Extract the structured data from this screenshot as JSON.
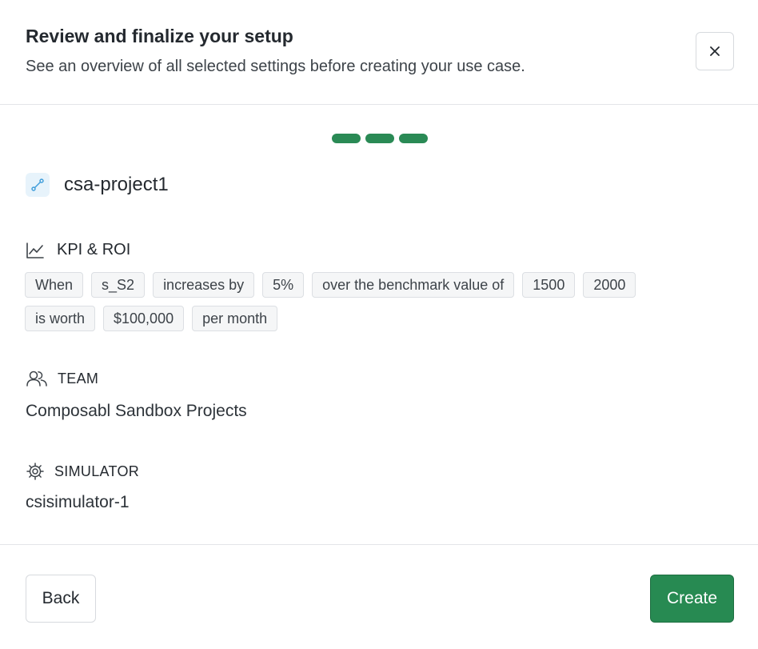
{
  "header": {
    "title": "Review and finalize your setup",
    "subtitle": "See an overview of all selected settings before creating your use case."
  },
  "stepper": {
    "steps_total": 3,
    "steps_completed": 3
  },
  "project": {
    "name": "csa-project1",
    "icon": "path-icon"
  },
  "kpi": {
    "label": "KPI & ROI",
    "icon": "trend-chart-icon",
    "chips": [
      "When",
      "s_S2",
      "increases by",
      "5%",
      "over the benchmark value of",
      "1500",
      "2000",
      "is worth",
      "$100,000",
      "per month"
    ]
  },
  "team": {
    "label": "TEAM",
    "icon": "users-icon",
    "value": "Composabl Sandbox Projects"
  },
  "simulator": {
    "label": "SIMULATOR",
    "icon": "simulator-gear-icon",
    "value": "csisimulator-1"
  },
  "footer": {
    "back_label": "Back",
    "create_label": "Create"
  },
  "colors": {
    "accent": "#278a52",
    "icon_blue": "#3a9bd9"
  }
}
